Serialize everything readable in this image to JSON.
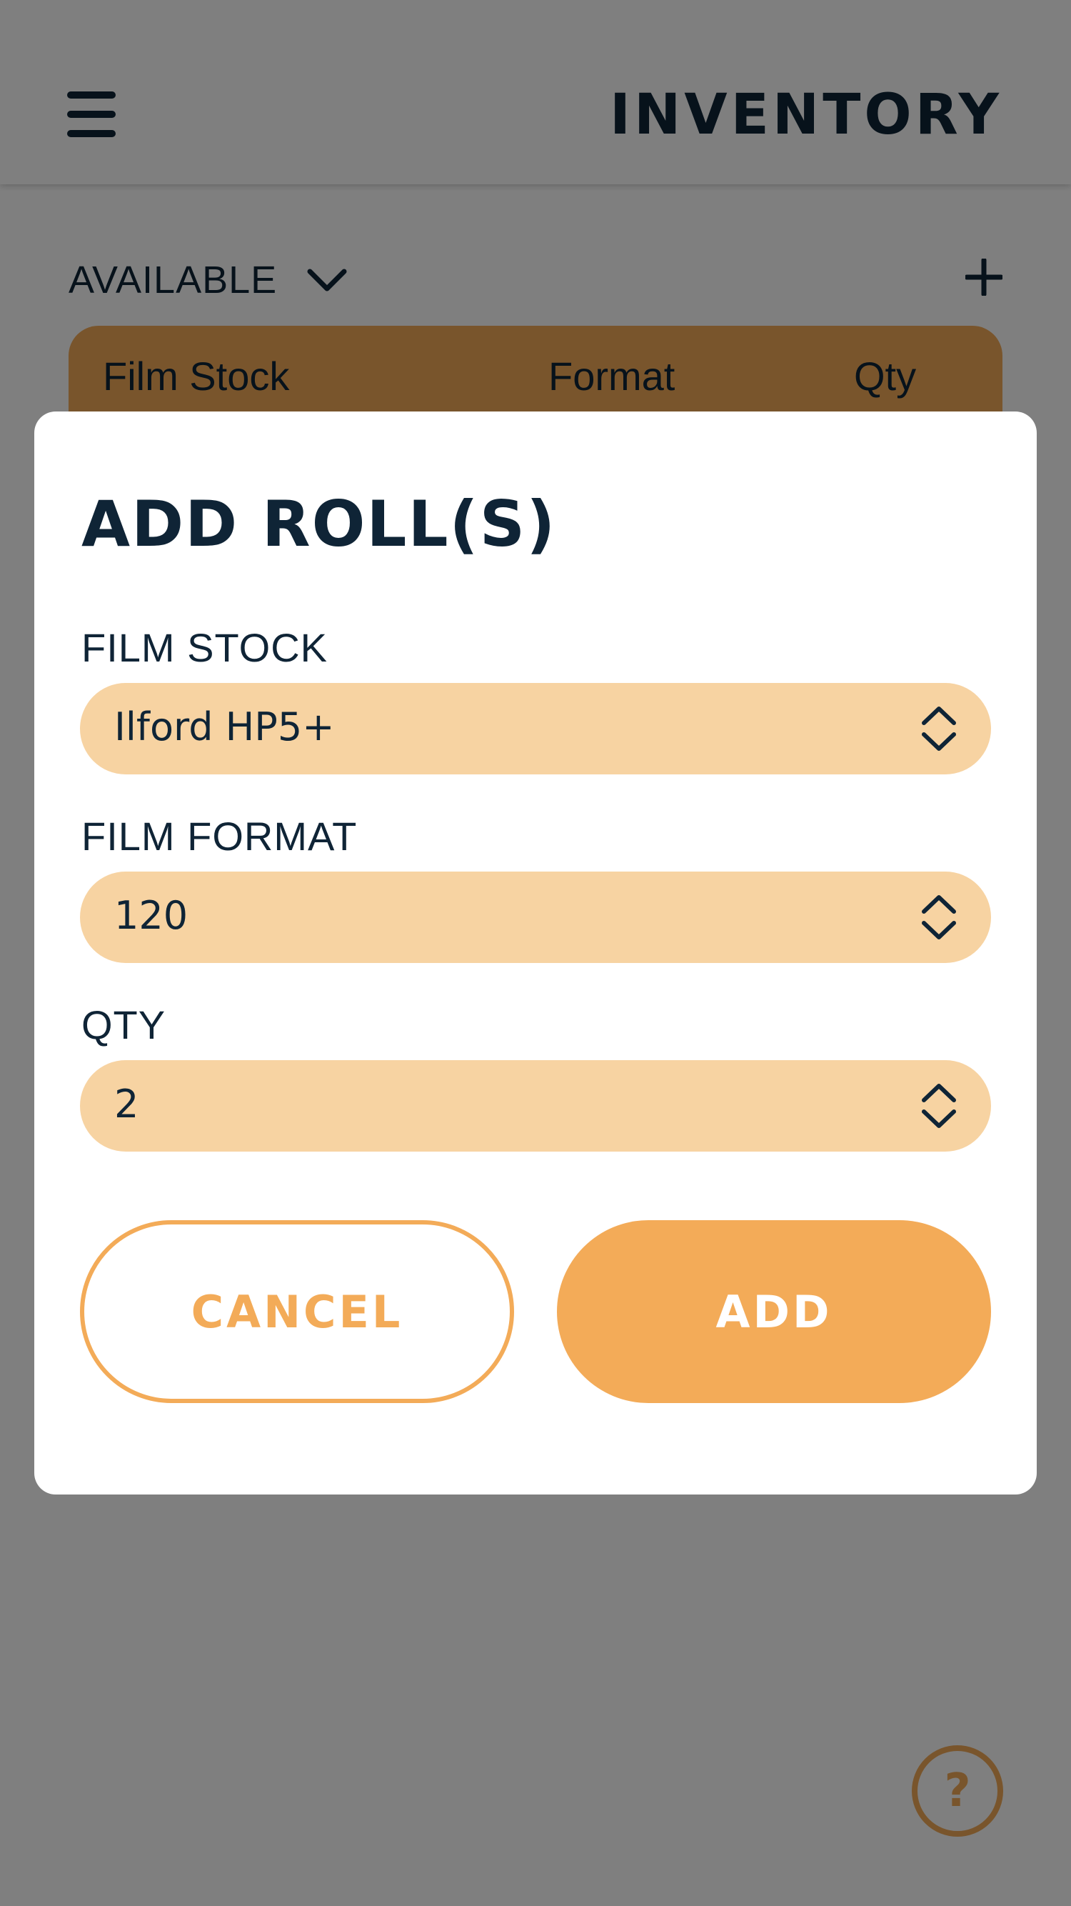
{
  "colors": {
    "accent": "#f3ab58",
    "field_fill": "#f7d3a2",
    "text_dark": "#0f2436",
    "scrim": "rgba(0,0,0,0.5)"
  },
  "header": {
    "menu_icon": "hamburger-menu-icon",
    "title": "INVENTORY"
  },
  "filter": {
    "label": "AVAILABLE",
    "dropdown_icon": "chevron-down-icon",
    "add_icon": "plus-icon"
  },
  "table": {
    "columns": [
      "Film Stock",
      "Format",
      "Qty"
    ]
  },
  "help": {
    "label": "?"
  },
  "dialog": {
    "title": "ADD ROLL(S)",
    "fields": [
      {
        "label": "FILM STOCK",
        "value": "Ilford HP5+"
      },
      {
        "label": "FILM FORMAT",
        "value": "120"
      },
      {
        "label": "QTY",
        "value": "2"
      }
    ],
    "cancel_label": "CANCEL",
    "add_label": "ADD"
  }
}
